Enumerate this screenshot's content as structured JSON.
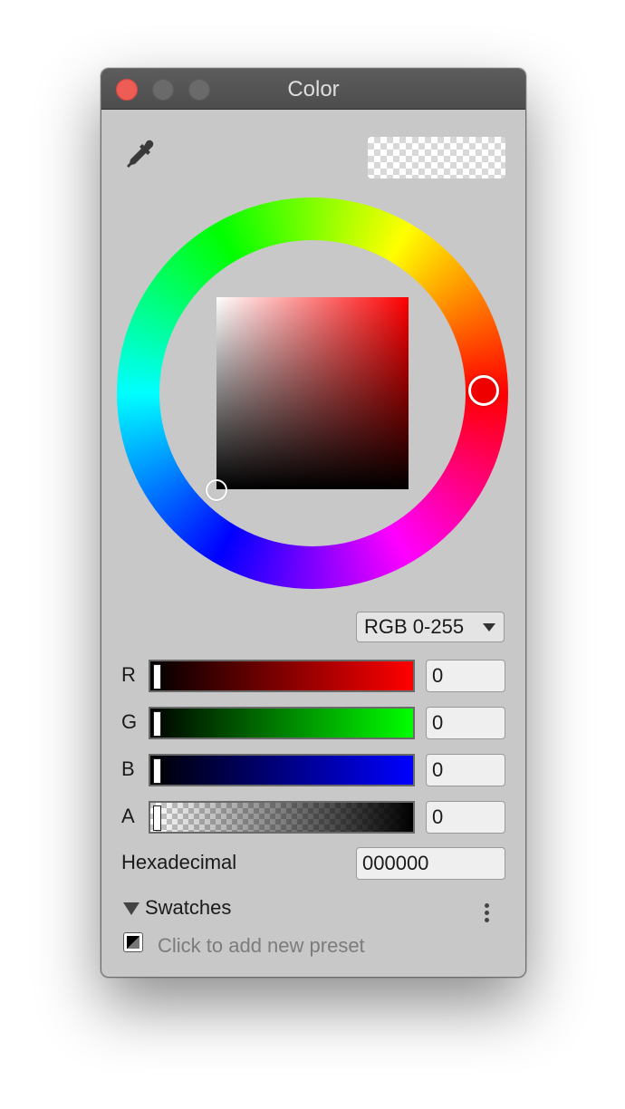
{
  "window": {
    "title": "Color"
  },
  "toolbar": {
    "eyedropper_icon": "eyedropper-icon"
  },
  "current_color": {
    "hex": "000000",
    "alpha": 0
  },
  "picker": {
    "hue_color": "#ff0000",
    "mode_label": "RGB 0-255"
  },
  "channels": [
    {
      "label": "R",
      "value": "0"
    },
    {
      "label": "G",
      "value": "0"
    },
    {
      "label": "B",
      "value": "0"
    },
    {
      "label": "A",
      "value": "0"
    }
  ],
  "hex": {
    "label": "Hexadecimal",
    "value": "000000"
  },
  "swatches": {
    "title": "Swatches",
    "add_preset_text": "Click to add new preset"
  }
}
